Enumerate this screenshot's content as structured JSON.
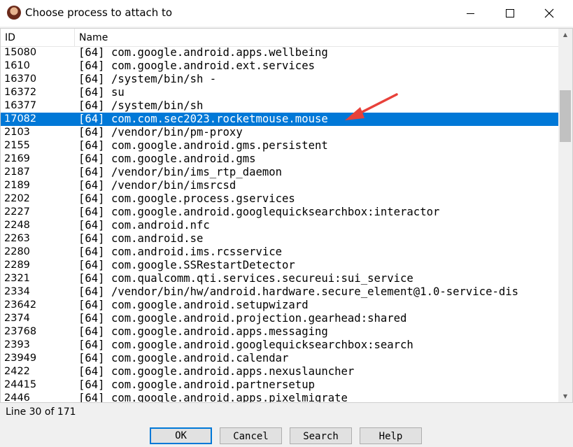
{
  "window": {
    "title": "Choose process to attach to"
  },
  "table": {
    "columns": {
      "id": "ID",
      "name": "Name"
    },
    "selected_index": 5,
    "rows": [
      {
        "id": "15080",
        "name": "[64] com.google.android.apps.wellbeing"
      },
      {
        "id": "1610",
        "name": "[64] com.google.android.ext.services"
      },
      {
        "id": "16370",
        "name": "[64] /system/bin/sh -"
      },
      {
        "id": "16372",
        "name": "[64] su"
      },
      {
        "id": "16377",
        "name": "[64] /system/bin/sh"
      },
      {
        "id": "17082",
        "name": "[64] com.com.sec2023.rocketmouse.mouse"
      },
      {
        "id": "2103",
        "name": "[64] /vendor/bin/pm-proxy"
      },
      {
        "id": "2155",
        "name": "[64] com.google.android.gms.persistent"
      },
      {
        "id": "2169",
        "name": "[64] com.google.android.gms"
      },
      {
        "id": "2187",
        "name": "[64] /vendor/bin/ims_rtp_daemon"
      },
      {
        "id": "2189",
        "name": "[64] /vendor/bin/imsrcsd"
      },
      {
        "id": "2202",
        "name": "[64] com.google.process.gservices"
      },
      {
        "id": "2227",
        "name": "[64] com.google.android.googlequicksearchbox:interactor"
      },
      {
        "id": "2248",
        "name": "[64] com.android.nfc"
      },
      {
        "id": "2263",
        "name": "[64] com.android.se"
      },
      {
        "id": "2280",
        "name": "[64] com.android.ims.rcsservice"
      },
      {
        "id": "2289",
        "name": "[64] com.google.SSRestartDetector"
      },
      {
        "id": "2321",
        "name": "[64] com.qualcomm.qti.services.secureui:sui_service"
      },
      {
        "id": "2334",
        "name": "[64] /vendor/bin/hw/android.hardware.secure_element@1.0-service-dis"
      },
      {
        "id": "23642",
        "name": "[64] com.google.android.setupwizard"
      },
      {
        "id": "2374",
        "name": "[64] com.google.android.projection.gearhead:shared"
      },
      {
        "id": "23768",
        "name": "[64] com.google.android.apps.messaging"
      },
      {
        "id": "2393",
        "name": "[64] com.google.android.googlequicksearchbox:search"
      },
      {
        "id": "23949",
        "name": "[64] com.google.android.calendar"
      },
      {
        "id": "2422",
        "name": "[64] com.google.android.apps.nexuslauncher"
      },
      {
        "id": "24415",
        "name": "[64] com.google.android.partnersetup"
      },
      {
        "id": "2446",
        "name": "[64] com.google.android.apps.pixelmigrate"
      }
    ]
  },
  "status": "Line 30 of 171",
  "buttons": {
    "ok": "OK",
    "cancel": "Cancel",
    "search": "Search",
    "help": "Help"
  },
  "colors": {
    "selection": "#0078d7",
    "annotation_arrow": "#e8413a"
  },
  "icons": {
    "app": "app-avatar-icon",
    "minimize": "minimize-icon",
    "maximize": "maximize-icon",
    "close": "close-icon",
    "scroll_up": "scroll-up-arrow-icon",
    "scroll_down": "scroll-down-arrow-icon"
  }
}
